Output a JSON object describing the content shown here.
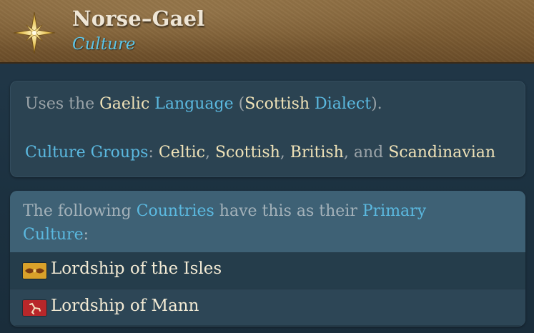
{
  "header": {
    "title": "Norse–Gael",
    "subtitle": "Culture",
    "icon": "compass-star-icon"
  },
  "language": {
    "prefix": "Uses the ",
    "language_name": "Gaelic",
    "language_word": "Language",
    "open_paren": " (",
    "dialect_name": "Scottish",
    "dialect_word": "Dialect",
    "close": ")."
  },
  "culture_groups": {
    "label": "Culture Groups",
    "colon": ": ",
    "groups": [
      "Celtic",
      "Scottish",
      "British",
      "Scandinavian"
    ],
    "sep": ", ",
    "and": ", and "
  },
  "countries": {
    "intro_prefix": "The following ",
    "intro_countries": "Countries",
    "intro_middle": " have this as their ",
    "intro_primary": "Primary",
    "intro_culture": "Culture",
    "intro_colon": ":",
    "items": [
      {
        "name": "Lordship of the Isles",
        "flag_color": "#d9a12a"
      },
      {
        "name": "Lordship of Mann",
        "flag_color": "#b8272a"
      }
    ]
  },
  "colors": {
    "gold_text": "#f0e3b8",
    "link_blue": "#5bb9e0",
    "muted": "#9aa3a8"
  }
}
